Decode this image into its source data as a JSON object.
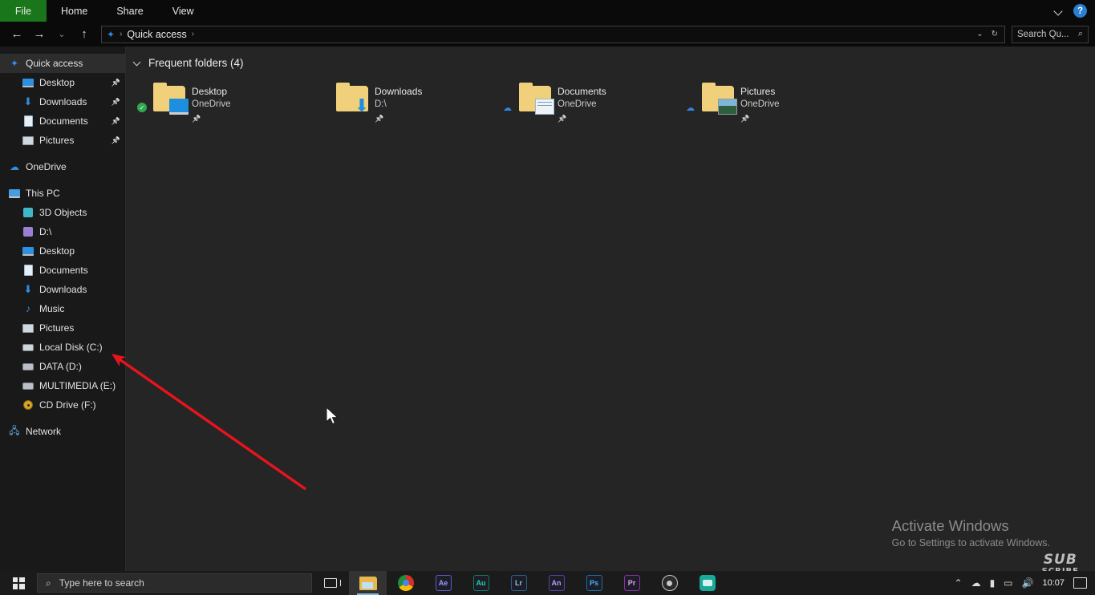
{
  "ribbon": {
    "file_tab": "File",
    "tabs": [
      "Home",
      "Share",
      "View"
    ],
    "expand_icon": "chevron-down-icon",
    "help_icon": "?"
  },
  "addressbar": {
    "back_icon": "←",
    "forward_icon": "→",
    "recent_icon": "⌄",
    "up_icon": "↑",
    "breadcrumb_icon": "✦",
    "breadcrumb": "Quick access",
    "breadcrumb_sep": "›",
    "dropdown_icon": "⌄",
    "refresh_icon": "↻",
    "search_placeholder": "Search Qu...",
    "search_icon": "⌕"
  },
  "sidebar": {
    "items": [
      {
        "label": "Quick access",
        "icon": "star-icon",
        "level": 0,
        "selected": true,
        "pinned": false
      },
      {
        "label": "Desktop",
        "icon": "desktop-icon",
        "level": 1,
        "selected": false,
        "pinned": true
      },
      {
        "label": "Downloads",
        "icon": "download-icon",
        "level": 1,
        "selected": false,
        "pinned": true
      },
      {
        "label": "Documents",
        "icon": "document-icon",
        "level": 1,
        "selected": false,
        "pinned": true
      },
      {
        "label": "Pictures",
        "icon": "picture-icon",
        "level": 1,
        "selected": false,
        "pinned": true
      },
      {
        "gap": true
      },
      {
        "label": "OneDrive",
        "icon": "cloud-icon",
        "level": 0,
        "selected": false,
        "pinned": false
      },
      {
        "gap": true
      },
      {
        "label": "This PC",
        "icon": "pc-icon",
        "level": 0,
        "selected": false,
        "pinned": false
      },
      {
        "label": "3D Objects",
        "icon": "3d-objects-icon",
        "level": 1,
        "selected": false,
        "pinned": false
      },
      {
        "label": "D:\\",
        "icon": "drive-d-icon",
        "level": 1,
        "selected": false,
        "pinned": false
      },
      {
        "label": "Desktop",
        "icon": "desktop-icon",
        "level": 1,
        "selected": false,
        "pinned": false
      },
      {
        "label": "Documents",
        "icon": "document-icon",
        "level": 1,
        "selected": false,
        "pinned": false
      },
      {
        "label": "Downloads",
        "icon": "download-icon",
        "level": 1,
        "selected": false,
        "pinned": false
      },
      {
        "label": "Music",
        "icon": "music-icon",
        "level": 1,
        "selected": false,
        "pinned": false
      },
      {
        "label": "Pictures",
        "icon": "picture-icon",
        "level": 1,
        "selected": false,
        "pinned": false
      },
      {
        "label": "Local Disk (C:)",
        "icon": "system-drive-icon",
        "level": 1,
        "selected": false,
        "pinned": false
      },
      {
        "label": "DATA (D:)",
        "icon": "drive-icon",
        "level": 1,
        "selected": false,
        "pinned": false
      },
      {
        "label": "MULTIMEDIA (E:)",
        "icon": "drive-icon",
        "level": 1,
        "selected": false,
        "pinned": false
      },
      {
        "label": "CD Drive (F:)",
        "icon": "cd-drive-icon",
        "level": 1,
        "selected": false,
        "pinned": false
      },
      {
        "gap": true
      },
      {
        "label": "Network",
        "icon": "network-icon",
        "level": 0,
        "selected": false,
        "pinned": false
      }
    ]
  },
  "content": {
    "group_title": "Frequent folders (4)",
    "tiles": [
      {
        "name": "Desktop",
        "location": "OneDrive",
        "badge": "synced-check",
        "overlay": "desktop-overlay",
        "pinned": true
      },
      {
        "name": "Downloads",
        "location": "D:\\",
        "badge": "none",
        "overlay": "download-overlay",
        "pinned": true
      },
      {
        "name": "Documents",
        "location": "OneDrive",
        "badge": "cloud",
        "overlay": "document-overlay",
        "pinned": true
      },
      {
        "name": "Pictures",
        "location": "OneDrive",
        "badge": "cloud",
        "overlay": "picture-overlay",
        "pinned": true
      }
    ]
  },
  "watermark": {
    "title": "Activate Windows",
    "subtitle": "Go to Settings to activate Windows."
  },
  "channel_watermark": {
    "line1": "SUB",
    "line2": "SCRIBE"
  },
  "annotation": {
    "color": "#e8141c",
    "points_to": "Local Disk (C:)"
  },
  "taskbar": {
    "start_icon": "windows-logo",
    "search_placeholder": "Type here to search",
    "search_icon": "⌕",
    "taskview_icon": "task-view-icon",
    "apps": [
      {
        "name": "File Explorer",
        "kind": "explorer",
        "active": true
      },
      {
        "name": "Google Chrome",
        "kind": "chrome",
        "active": false
      },
      {
        "name": "After Effects",
        "kind": "adobe",
        "short": "Ae",
        "color": "#9a9aff",
        "border": "#5c5cc8",
        "active": false
      },
      {
        "name": "Audition",
        "kind": "adobe",
        "short": "Au",
        "color": "#22d2b0",
        "border": "#0e7c66",
        "active": false
      },
      {
        "name": "Lightroom",
        "kind": "adobe",
        "short": "Lr",
        "color": "#86c6f5",
        "border": "#2a5f8f",
        "active": false
      },
      {
        "name": "Animate",
        "kind": "adobe",
        "short": "An",
        "color": "#b79bff",
        "border": "#5b3fa8",
        "active": false
      },
      {
        "name": "Photoshop",
        "kind": "adobe",
        "short": "Ps",
        "color": "#45b5ff",
        "border": "#1b6fa8",
        "active": false
      },
      {
        "name": "Premiere Pro",
        "kind": "adobe",
        "short": "Pr",
        "color": "#e89cff",
        "border": "#8a2fa8",
        "active": false
      },
      {
        "name": "OBS Studio",
        "kind": "obs",
        "active": false
      },
      {
        "name": "Recorder",
        "kind": "teal",
        "active": false
      }
    ],
    "tray": {
      "show_hidden_icon": "⌃",
      "cloud_icon": "☁",
      "usb_icon": "▮",
      "display_icon": "▭",
      "volume_icon": "🔊",
      "time": "10:07",
      "notification_icon": "notification-icon"
    }
  }
}
